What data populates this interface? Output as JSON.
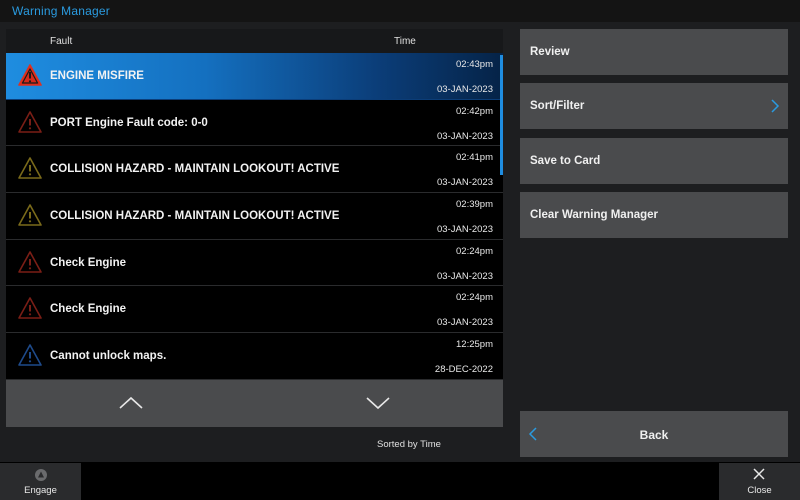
{
  "window": {
    "title": "Warning Manager"
  },
  "list": {
    "header_fault": "Fault",
    "header_time": "Time",
    "rows": [
      {
        "fault": "ENGINE MISFIRE",
        "time": "02:43pm",
        "date": "03-JAN-2023",
        "severity": "alarm",
        "icon": "warning-icon",
        "color": "#e0301e",
        "selected": true
      },
      {
        "fault": "PORT Engine Fault code: 0-0",
        "time": "02:42pm",
        "date": "03-JAN-2023",
        "severity": "alarm",
        "icon": "warning-icon",
        "color": "#7a1e16",
        "selected": false
      },
      {
        "fault": "COLLISION HAZARD - MAINTAIN LOOKOUT! ACTIVE",
        "time": "02:41pm",
        "date": "03-JAN-2023",
        "severity": "warning",
        "icon": "warning-icon",
        "color": "#7a6a1a",
        "selected": false
      },
      {
        "fault": "COLLISION HAZARD - MAINTAIN LOOKOUT! ACTIVE",
        "time": "02:39pm",
        "date": "03-JAN-2023",
        "severity": "warning",
        "icon": "warning-icon",
        "color": "#7a6a1a",
        "selected": false
      },
      {
        "fault": "Check Engine",
        "time": "02:24pm",
        "date": "03-JAN-2023",
        "severity": "alarm",
        "icon": "warning-icon",
        "color": "#7a1e16",
        "selected": false
      },
      {
        "fault": "Check Engine",
        "time": "02:24pm",
        "date": "03-JAN-2023",
        "severity": "alarm",
        "icon": "warning-icon",
        "color": "#7a1e16",
        "selected": false
      },
      {
        "fault": "Cannot unlock maps.",
        "time": "12:25pm",
        "date": "28-DEC-2022",
        "severity": "info",
        "icon": "warning-icon",
        "color": "#1e4a8a",
        "selected": false
      }
    ],
    "sorted_label": "Sorted by Time"
  },
  "actions": {
    "review": "Review",
    "sort_filter": "Sort/Filter",
    "save_to_card": "Save to Card",
    "clear": "Clear Warning Manager",
    "back": "Back"
  },
  "bottom_bar": {
    "engage": "Engage",
    "close": "Close"
  },
  "colors": {
    "accent": "#1f8de0",
    "title": "#2a9be0",
    "button": "#4a4b4d"
  }
}
